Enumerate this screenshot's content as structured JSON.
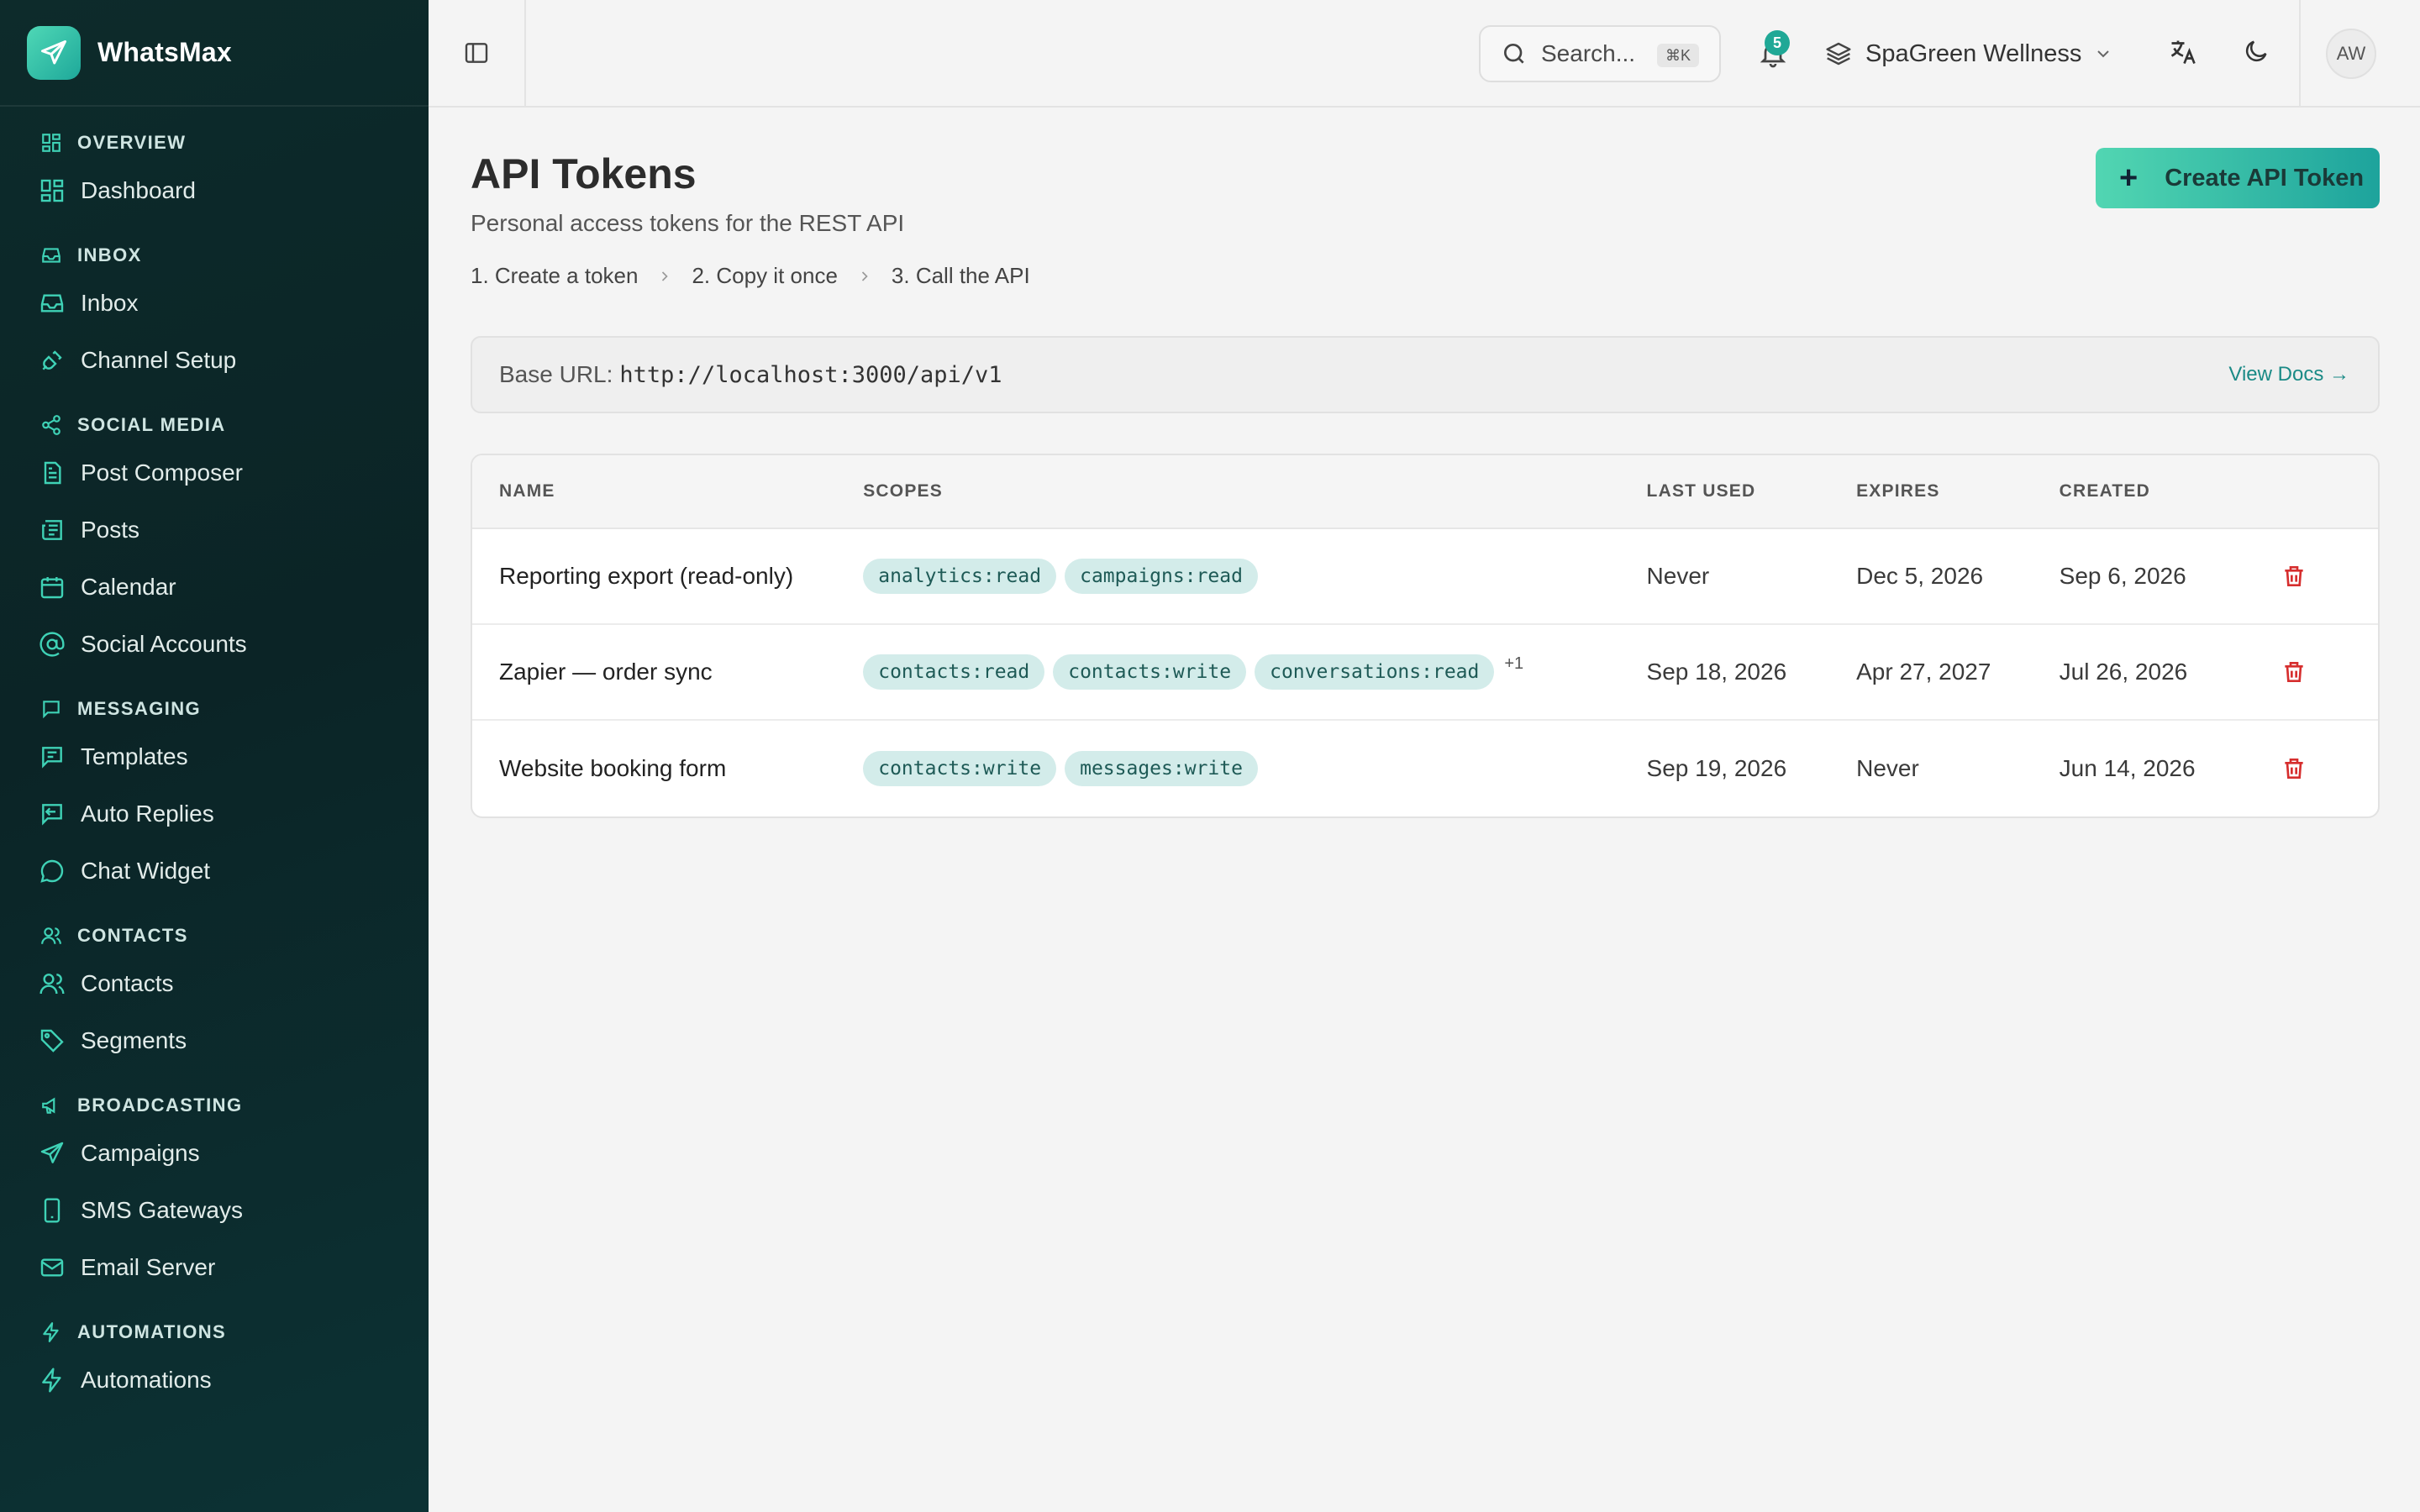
{
  "app": {
    "name": "WhatsMax"
  },
  "sidebar": {
    "sections": [
      {
        "title": "OVERVIEW",
        "icon": "grid-icon",
        "items": [
          {
            "label": "Dashboard",
            "icon": "grid-icon"
          }
        ]
      },
      {
        "title": "INBOX",
        "icon": "inbox-icon",
        "items": [
          {
            "label": "Inbox",
            "icon": "inbox-icon"
          },
          {
            "label": "Channel Setup",
            "icon": "plug-icon"
          }
        ]
      },
      {
        "title": "SOCIAL MEDIA",
        "icon": "share-icon",
        "items": [
          {
            "label": "Post Composer",
            "icon": "document-icon"
          },
          {
            "label": "Posts",
            "icon": "newspaper-icon"
          },
          {
            "label": "Calendar",
            "icon": "calendar-icon"
          },
          {
            "label": "Social Accounts",
            "icon": "at-icon"
          }
        ]
      },
      {
        "title": "MESSAGING",
        "icon": "message-icon",
        "items": [
          {
            "label": "Templates",
            "icon": "template-icon"
          },
          {
            "label": "Auto Replies",
            "icon": "reply-icon"
          },
          {
            "label": "Chat Widget",
            "icon": "chat-bubble-icon"
          }
        ]
      },
      {
        "title": "CONTACTS",
        "icon": "users-icon",
        "items": [
          {
            "label": "Contacts",
            "icon": "users-icon"
          },
          {
            "label": "Segments",
            "icon": "tag-icon"
          }
        ]
      },
      {
        "title": "BROADCASTING",
        "icon": "megaphone-icon",
        "items": [
          {
            "label": "Campaigns",
            "icon": "send-icon"
          },
          {
            "label": "SMS Gateways",
            "icon": "phone-icon"
          },
          {
            "label": "Email Server",
            "icon": "mail-icon"
          }
        ]
      },
      {
        "title": "AUTOMATIONS",
        "icon": "bolt-icon",
        "items": [
          {
            "label": "Automations",
            "icon": "bolt-icon"
          }
        ]
      }
    ]
  },
  "topbar": {
    "search_placeholder": "Search...",
    "search_shortcut": "⌘K",
    "notification_count": "5",
    "workspace_name": "SpaGreen Wellness",
    "avatar_initials": "AW"
  },
  "page": {
    "title": "API Tokens",
    "subtitle": "Personal access tokens for the REST API",
    "steps": [
      "1.  Create a token",
      "2.  Copy it once",
      "3.  Call the API"
    ],
    "create_button": "Create API Token",
    "base_url_label": "Base URL:",
    "base_url": "http://localhost:3000/api/v1",
    "view_docs": "View Docs →"
  },
  "table": {
    "headers": {
      "name": "NAME",
      "scopes": "SCOPES",
      "last_used": "LAST USED",
      "expires": "EXPIRES",
      "created": "CREATED"
    },
    "rows": [
      {
        "name": "Reporting export (read-only)",
        "scopes": [
          "analytics:read",
          "campaigns:read"
        ],
        "more": "",
        "last_used": "Never",
        "expires": "Dec 5, 2026",
        "created": "Sep 6, 2026"
      },
      {
        "name": "Zapier — order sync",
        "scopes": [
          "contacts:read",
          "contacts:write",
          "conversations:read"
        ],
        "more": "+1",
        "last_used": "Sep 18, 2026",
        "expires": "Apr 27, 2027",
        "created": "Jul 26, 2026"
      },
      {
        "name": "Website booking form",
        "scopes": [
          "contacts:write",
          "messages:write"
        ],
        "more": "",
        "last_used": "Sep 19, 2026",
        "expires": "Never",
        "created": "Jun 14, 2026"
      }
    ]
  },
  "colors": {
    "accent": "#20a896",
    "sidebar_bg": "#0d2b2b",
    "danger": "#d62e2e"
  }
}
